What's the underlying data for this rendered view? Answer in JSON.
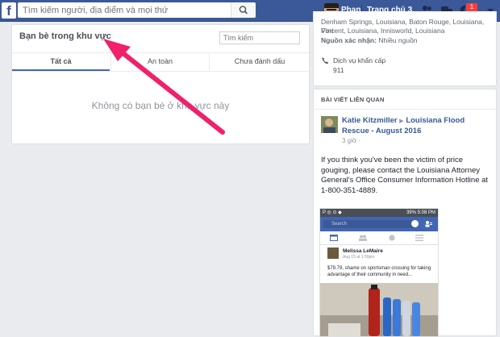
{
  "topbar": {
    "logo": "f",
    "search_placeholder": "Tìm kiếm người, địa điểm và mọi thứ",
    "user_name": "Phan",
    "home_label": "Trang chủ",
    "home_count": "3",
    "notification_count": "1",
    "accent": "#3b5998"
  },
  "left_panel": {
    "title": "Bạn bè trong khu vực",
    "search_placeholder": "Tìm kiếm",
    "tabs": [
      {
        "label": "Tất cả",
        "active": true
      },
      {
        "label": "An toàn",
        "active": false
      },
      {
        "label": "Chưa đánh dấu",
        "active": false
      }
    ],
    "empty_message": "Không có bạn bè ở khu vực này"
  },
  "right_info": {
    "location_line1": "Denham Springs, Louisiana, Baton Rouge, Louisiana, Port",
    "location_line2": "Vincent, Louisiana, Innisworld, Louisiana",
    "source_label": "Nguồn xác nhận:",
    "source_value": "Nhiều nguồn",
    "service_label": "Dịch vụ khẩn cấp",
    "service_number": "911"
  },
  "related_post": {
    "header": "BÀI VIẾT LIÊN QUAN",
    "author": "Katie Kitzmiller",
    "group": "Louisiana Flood Rescue - August 2016",
    "time": "3 giờ",
    "body": "If you think you've been the victim of price gouging, please contact the Louisiana Attorney General's Office Consumer Information Hotline at 1-800-351-4889."
  },
  "embedded_screenshot": {
    "status_time": "5:08 PM",
    "status_battery": "39%",
    "search_placeholder": "Search",
    "poster_name": "Melissa LeMaire",
    "poster_time": "Aug 15 at 1:50pm",
    "post_text": "$79.79, shame on sportsman crossing for taking advantage of their community in need..."
  }
}
